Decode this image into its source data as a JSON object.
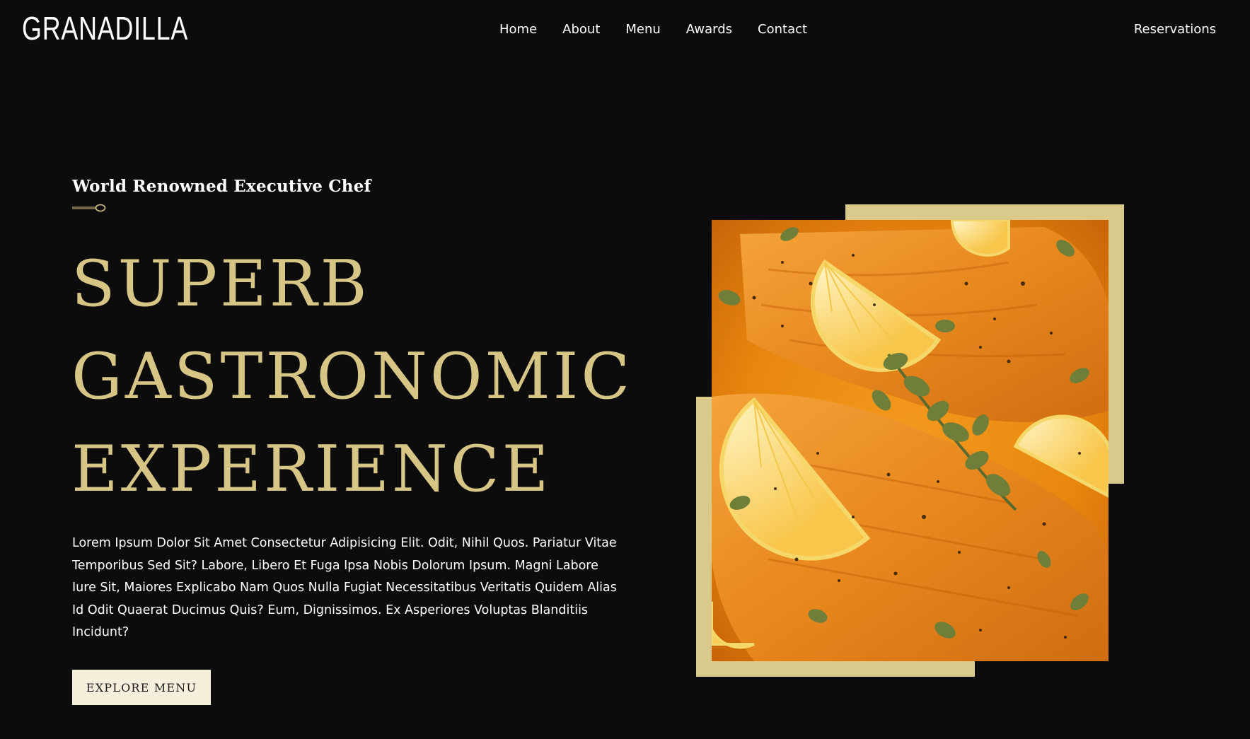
{
  "header": {
    "logo": "GRANADILLA",
    "nav": [
      "Home",
      "About",
      "Menu",
      "Awards",
      "Contact"
    ],
    "reservations_label": "Reservations"
  },
  "hero": {
    "kicker": "World Renowned Executive Chef",
    "headline_lines": [
      "SUPERB",
      "GASTRONOMIC",
      "EXPERIENCE"
    ],
    "description": "Lorem Ipsum Dolor Sit Amet Consectetur Adipisicing Elit. Odit, Nihil Quos. Pariatur Vitae Temporibus Sed Sit? Labore, Libero Et Fuga Ipsa Nobis Dolorum Ipsum. Magni Labore Iure Sit, Maiores Explicabo Nam Quos Nulla Fugiat Necessitatibus Veritatis Quidem Alias Id Odit Quaerat Ducimus Quis? Eum, Dignissimos. Ex Asperiores Voluptas Blanditiis Incidunt?",
    "cta_label": "EXPLORE MENU"
  },
  "image": {
    "subject": "salmon-fillets-with-lemon-and-oregano",
    "icon": "spoon-icon"
  },
  "colors": {
    "background": "#0c0c0c",
    "accent_gold": "#d7c585",
    "frame_gold": "#d9c98a",
    "button_bg": "#f6efdc"
  }
}
